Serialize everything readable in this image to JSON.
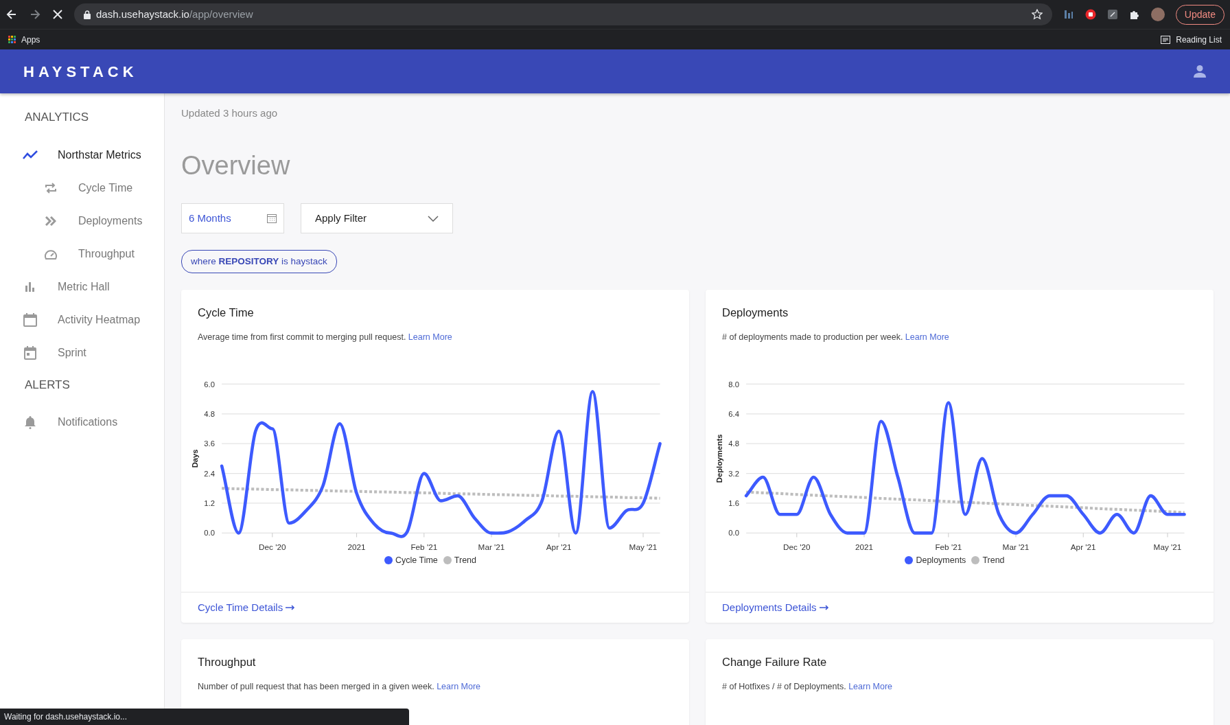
{
  "browser": {
    "url_host": "dash.usehaystack.io",
    "url_path": "/app/overview",
    "update_button": "Update",
    "bookmarks": [
      "Apps"
    ],
    "reading_list": "Reading List"
  },
  "header": {
    "logo": "HAYSTACK"
  },
  "sidebar": {
    "sections": [
      {
        "title": "ANALYTICS",
        "items": [
          {
            "label": "Northstar Metrics",
            "selected": true,
            "children": [
              {
                "label": "Cycle Time",
                "selected": false
              },
              {
                "label": "Deployments",
                "selected": false
              },
              {
                "label": "Throughput",
                "selected": false
              }
            ]
          },
          {
            "label": "Metric Hall",
            "selected": false
          },
          {
            "label": "Activity Heatmap",
            "selected": false
          },
          {
            "label": "Sprint",
            "selected": false
          }
        ]
      },
      {
        "title": "ALERTS",
        "items": [
          {
            "label": "Notifications",
            "selected": false
          }
        ]
      }
    ]
  },
  "main": {
    "updated": "Updated 3 hours ago",
    "title": "Overview",
    "period_field": {
      "value": "6 Months"
    },
    "filter_dropdown": {
      "label": "Apply Filter"
    },
    "filter_chip": "where **REPOSITORY** is haystack",
    "cards": [
      {
        "title": "Cycle Time",
        "description": "Average time from first commit to merging pull request.",
        "link": "Learn More",
        "details_link": "Cycle Time Details",
        "chart_data": {
          "type": "line",
          "ylabel": "Days",
          "grid": true,
          "legend": "bottom",
          "categories": [
            null,
            null,
            null,
            "Dec '20",
            null,
            null,
            null,
            null,
            "2021",
            null,
            null,
            null,
            "Feb '21",
            null,
            null,
            null,
            "Mar '21",
            null,
            null,
            null,
            "Apr '21",
            null,
            null,
            null,
            null,
            "May '21",
            null
          ],
          "ylim": [
            0,
            6
          ],
          "yticks": [
            {
              "value": 0,
              "label": "0.0"
            },
            {
              "value": 1.2,
              "label": "1.2"
            },
            {
              "value": 2.4,
              "label": "2.4"
            },
            {
              "value": 3.6,
              "label": "3.6"
            },
            {
              "value": 4.8,
              "label": "4.8"
            },
            {
              "value": 6,
              "label": "6.0"
            }
          ],
          "series": [
            {
              "name": "Cycle Time",
              "color": "#3d5afe",
              "line_style": "solid",
              "values": [
                2.7,
                0.0,
                4.1,
                4.2,
                0.4,
                0.9,
                1.9,
                4.4,
                1.6,
                0.4,
                0.0,
                0.05,
                2.4,
                1.3,
                1.5,
                0.6,
                0.0,
                0.05,
                0.5,
                1.3,
                4.1,
                0.0,
                5.7,
                0.2,
                0.9,
                1.2,
                3.6
              ]
            },
            {
              "name": "Trend",
              "color": "#bdbdbd",
              "line_style": "dashed",
              "values": [
                1.8,
                1.78,
                1.77,
                1.75,
                1.74,
                1.72,
                1.71,
                1.69,
                1.68,
                1.66,
                1.65,
                1.63,
                1.62,
                1.6,
                1.58,
                1.57,
                1.55,
                1.54,
                1.52,
                1.51,
                1.49,
                1.48,
                1.46,
                1.45,
                1.43,
                1.42,
                1.4
              ]
            }
          ]
        }
      },
      {
        "title": "Deployments",
        "description": "# of deployments made to production per week.",
        "link": "Learn More",
        "details_link": "Deployments Details",
        "chart_data": {
          "type": "line",
          "ylabel": "Deployments",
          "grid": true,
          "legend": "bottom",
          "categories": [
            null,
            null,
            null,
            "Dec '20",
            null,
            null,
            null,
            "2021",
            null,
            null,
            null,
            null,
            "Feb '21",
            null,
            null,
            null,
            "Mar '21",
            null,
            null,
            null,
            "Apr '21",
            null,
            null,
            null,
            null,
            "May '21",
            null
          ],
          "ylim": [
            0,
            8
          ],
          "yticks": [
            {
              "value": 0,
              "label": "0.0"
            },
            {
              "value": 1.6,
              "label": "1.6"
            },
            {
              "value": 3.2,
              "label": "3.2"
            },
            {
              "value": 4.8,
              "label": "4.8"
            },
            {
              "value": 6.4,
              "label": "6.4"
            },
            {
              "value": 8,
              "label": "8.0"
            }
          ],
          "series": [
            {
              "name": "Deployments",
              "color": "#3d5afe",
              "line_style": "solid",
              "values": [
                2,
                3,
                1,
                1,
                3,
                1,
                0,
                0,
                6,
                3,
                0,
                0,
                7,
                1,
                4,
                1,
                0,
                1,
                2,
                2,
                1,
                0,
                1,
                0,
                2,
                1,
                1
              ]
            },
            {
              "name": "Trend",
              "color": "#bdbdbd",
              "line_style": "dashed",
              "values": [
                2.2,
                2.16,
                2.12,
                2.07,
                2.03,
                1.99,
                1.95,
                1.91,
                1.86,
                1.82,
                1.78,
                1.74,
                1.69,
                1.65,
                1.61,
                1.57,
                1.53,
                1.48,
                1.44,
                1.4,
                1.36,
                1.31,
                1.27,
                1.23,
                1.19,
                1.15,
                1.1
              ]
            }
          ]
        }
      },
      {
        "title": "Throughput",
        "description": "Number of pull request that has been merged in a given week.",
        "link": "Learn More"
      },
      {
        "title": "Change Failure Rate",
        "description": "# of Hotfixes / # of Deployments.",
        "link": "Learn More"
      }
    ]
  },
  "status_bar": "Waiting for dash.usehaystack.io..."
}
